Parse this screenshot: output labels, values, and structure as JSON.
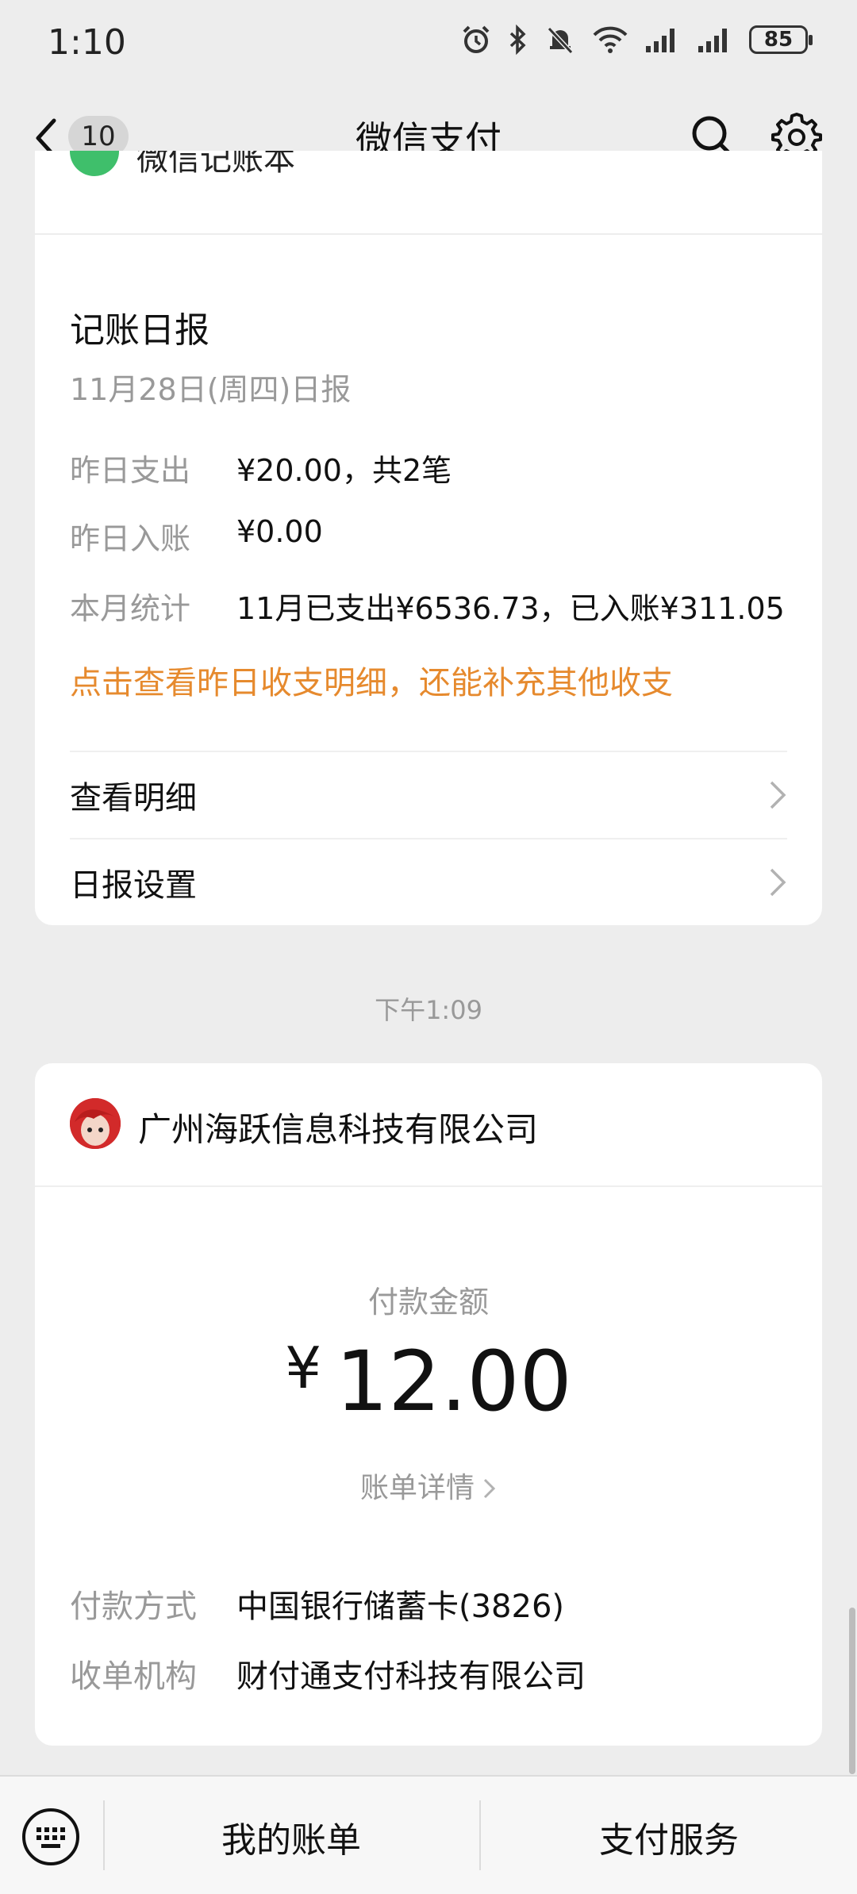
{
  "status_bar": {
    "time": "1:10",
    "battery": "85"
  },
  "nav": {
    "unread_count": "10",
    "title": "微信支付"
  },
  "previous_card": {
    "name": "微信记账本"
  },
  "report": {
    "title": "记账日报",
    "date": "11月28日(周四)日报",
    "rows": [
      {
        "label": "昨日支出",
        "value": "¥20.00，共2笔"
      },
      {
        "label": "昨日入账",
        "value": "¥0.00"
      },
      {
        "label": "本月统计",
        "value": "11月已支出¥6536.73，已入账¥311.05"
      }
    ],
    "tip": "点击查看昨日收支明细，还能补充其他收支",
    "menu": [
      {
        "label": "查看明细"
      },
      {
        "label": "日报设置"
      }
    ]
  },
  "timestamp": "下午1:09",
  "payment": {
    "merchant": "广州海跃信息科技有限公司",
    "amount_label": "付款金额",
    "currency": "¥",
    "amount": "12.00",
    "bill_detail": "账单详情",
    "rows": [
      {
        "label": "付款方式",
        "value": "中国银行储蓄卡(3826)"
      },
      {
        "label": "收单机构",
        "value": "财付通支付科技有限公司"
      }
    ]
  },
  "bottom_bar": {
    "tabs": [
      {
        "label": "我的账单"
      },
      {
        "label": "支付服务"
      }
    ]
  }
}
